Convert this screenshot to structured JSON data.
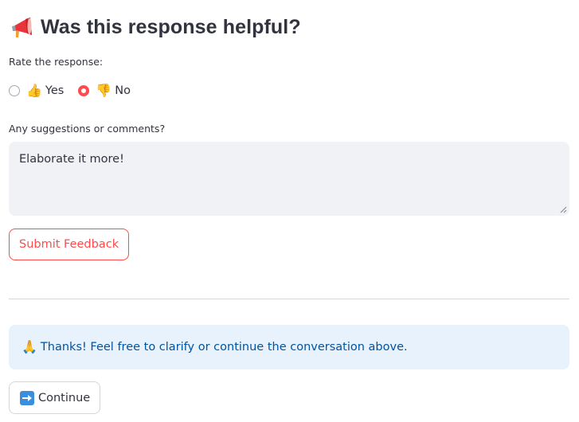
{
  "header": {
    "title": "Was this response helpful?",
    "title_icon": "megaphone-icon"
  },
  "rating": {
    "label": "Rate the response:",
    "options": [
      {
        "emoji": "👍",
        "icon": "thumbs-up-icon",
        "label": "Yes",
        "selected": false
      },
      {
        "emoji": "👎",
        "icon": "thumbs-down-icon",
        "label": "No",
        "selected": true
      }
    ],
    "selected_value": "No"
  },
  "comments": {
    "label": "Any suggestions or comments?",
    "value": "Elaborate it more!"
  },
  "submit": {
    "label": "Submit Feedback"
  },
  "info": {
    "emoji": "🙏",
    "icon": "folded-hands-icon",
    "message": "Thanks! Feel free to clarify or continue the conversation above."
  },
  "continue": {
    "icon": "right-arrow-icon",
    "label": "Continue"
  },
  "colors": {
    "accent": "#ff4b4b",
    "info_bg": "#e8f2fc",
    "info_text": "#0054a3",
    "text": "#31333f",
    "input_bg": "#f0f2f6"
  }
}
